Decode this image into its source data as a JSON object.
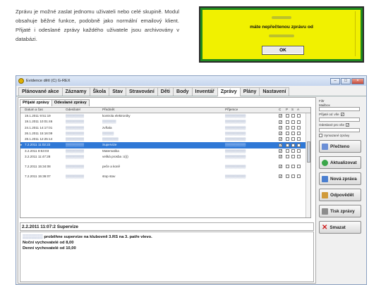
{
  "doc": {
    "paragraph": "Zprávu je možné zaslat jednomu uživateli nebo celé skupině. Modul obsahuje běžné funkce, podobně jako normální emailový klient. Přijaté i odeslané zprávy každého uživatele jsou archivovány v databázi."
  },
  "notice": {
    "message": "máte nepřečtenou zprávu od",
    "ok_label": "OK"
  },
  "window": {
    "title": "Evidence dětí (C) G-REX",
    "tabs": [
      "Plánované akce",
      "Záznamy",
      "Škola",
      "Stav",
      "Stravování",
      "Děti",
      "Body",
      "Inventář",
      "Zprávy",
      "Plány",
      "Nastavení"
    ],
    "active_tab": "Zprávy",
    "subtabs": [
      "Přijaté zprávy",
      "Odeslané zprávy"
    ],
    "columns": [
      "Datum a čas",
      "Odesílatel",
      "Předmět",
      "Příjemce",
      "C",
      "P",
      "S",
      "A"
    ],
    "rows": [
      {
        "date": "19.1.2011 9:51:19",
        "subject": "kontrola elektroniky"
      },
      {
        "date": "19.1.2011 10:01:46",
        "subject": ""
      },
      {
        "date": "24.1.2011 14:17:01",
        "subject": "zvřtala"
      },
      {
        "date": "26.1.2011 15:16:09",
        "subject": ""
      },
      {
        "date": "28.1.2011 12:25:14",
        "subject": ""
      },
      {
        "date": "7.2.2011 11:02:22",
        "subject": "Supervize"
      },
      {
        "date": "3.2.2011 8:53:03",
        "subject": "Matematika"
      },
      {
        "date": "3.2.2011 11:47:28",
        "subject": "veliká prosba :o)))"
      },
      {
        "date": "7.2.2011 15:34:08",
        "subject": "peče a koně"
      },
      {
        "date": "7.2.2011 15:36:07",
        "subject": "stop stav"
      }
    ],
    "selected_subject": "2.2.2011 11:07:2  Supervize",
    "body_lines": [
      "proběhne supervize na klubovně 3.RS na 3. patře vlevo.",
      "Noční vychovatelé od 8,00",
      "Denní vychovatelé od 10,00"
    ],
    "sidebar": {
      "filter_label": "Filtr",
      "labels": [
        "Mailbox",
        "Přijaté od",
        "vše",
        "Odeslané pro vše",
        "Vyber uživatele",
        "Vymazané zprávy"
      ],
      "buttons": [
        "Přečteno",
        "Aktualizovat",
        "Nová zpráva",
        "Odpovědět",
        "Tisk zprávy",
        "Smazat"
      ]
    }
  },
  "colors": {
    "notice_yellow": "#f1f100",
    "notice_border": "#1f8a1f",
    "selection_blue": "#2f78d6"
  }
}
